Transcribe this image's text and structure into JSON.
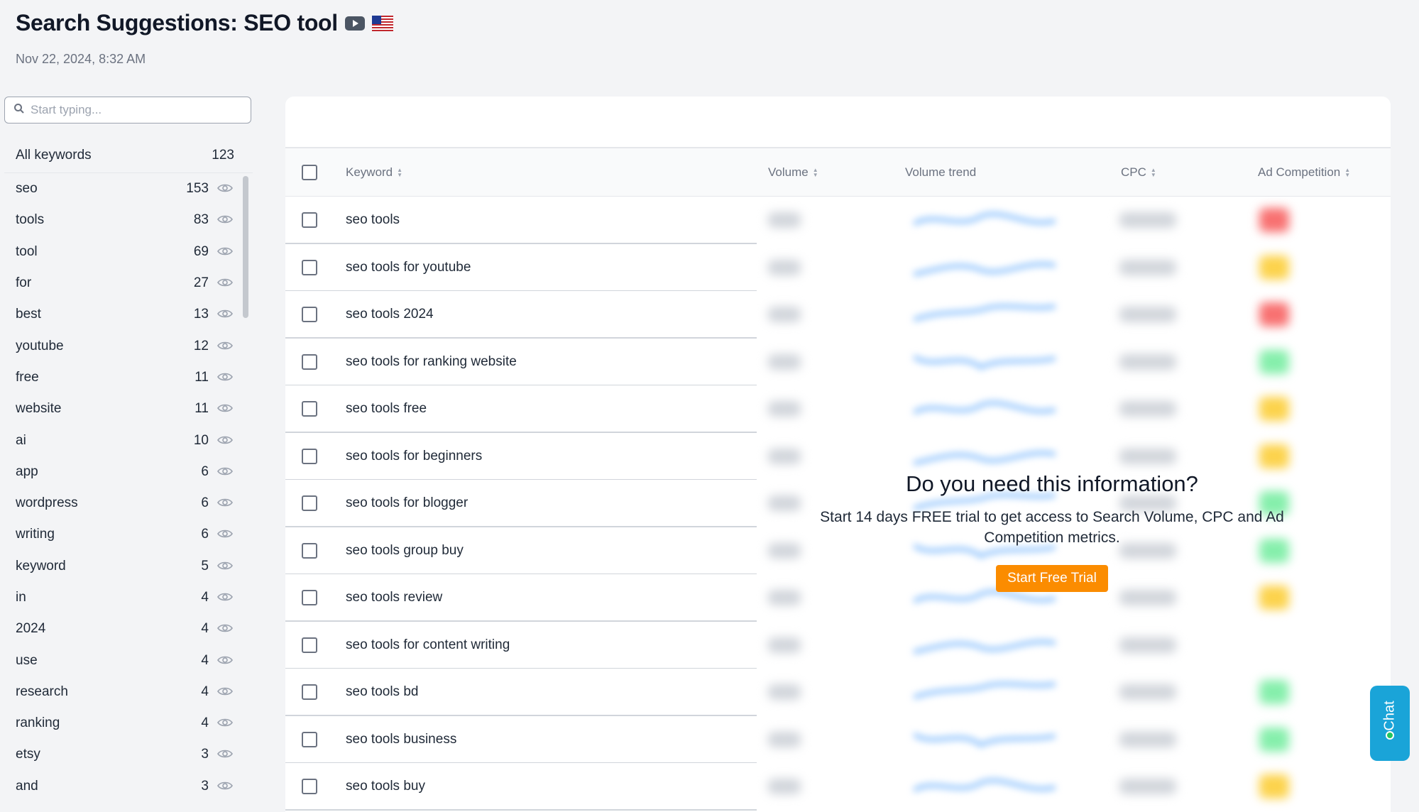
{
  "header": {
    "title": "Search Suggestions: SEO tool",
    "date": "Nov 22, 2024, 8:32 AM"
  },
  "sidebar": {
    "search_placeholder": "Start typing...",
    "all_label": "All keywords",
    "all_count": "123",
    "items": [
      {
        "label": "seo",
        "count": "153"
      },
      {
        "label": "tools",
        "count": "83"
      },
      {
        "label": "tool",
        "count": "69"
      },
      {
        "label": "for",
        "count": "27"
      },
      {
        "label": "best",
        "count": "13"
      },
      {
        "label": "youtube",
        "count": "12"
      },
      {
        "label": "free",
        "count": "11"
      },
      {
        "label": "website",
        "count": "11"
      },
      {
        "label": "ai",
        "count": "10"
      },
      {
        "label": "app",
        "count": "6"
      },
      {
        "label": "wordpress",
        "count": "6"
      },
      {
        "label": "writing",
        "count": "6"
      },
      {
        "label": "keyword",
        "count": "5"
      },
      {
        "label": "in",
        "count": "4"
      },
      {
        "label": "2024",
        "count": "4"
      },
      {
        "label": "use",
        "count": "4"
      },
      {
        "label": "research",
        "count": "4"
      },
      {
        "label": "ranking",
        "count": "4"
      },
      {
        "label": "etsy",
        "count": "3"
      },
      {
        "label": "and",
        "count": "3"
      }
    ]
  },
  "table": {
    "columns": {
      "keyword": "Keyword",
      "volume": "Volume",
      "trend": "Volume trend",
      "cpc": "CPC",
      "competition": "Ad Competition"
    },
    "rows": [
      {
        "keyword": "seo tools",
        "competition_color": "#f87171"
      },
      {
        "keyword": "seo tools for youtube",
        "competition_color": "#fcd34d"
      },
      {
        "keyword": "seo tools 2024",
        "competition_color": "#f87171"
      },
      {
        "keyword": "seo tools for ranking website",
        "competition_color": "#86efac"
      },
      {
        "keyword": "seo tools free",
        "competition_color": "#fcd34d"
      },
      {
        "keyword": "seo tools for beginners",
        "competition_color": "#fcd34d"
      },
      {
        "keyword": "seo tools for blogger",
        "competition_color": "#86efac"
      },
      {
        "keyword": "seo tools group buy",
        "competition_color": "#86efac"
      },
      {
        "keyword": "seo tools review",
        "competition_color": "#fcd34d"
      },
      {
        "keyword": "seo tools for content writing",
        "competition_color": ""
      },
      {
        "keyword": "seo tools bd",
        "competition_color": "#86efac"
      },
      {
        "keyword": "seo tools business",
        "competition_color": "#86efac"
      },
      {
        "keyword": "seo tools buy",
        "competition_color": "#fcd34d"
      }
    ]
  },
  "paywall": {
    "heading": "Do you need this information?",
    "text": "Start 14 days FREE trial to get access to Search Volume, CPC and Ad Competition metrics.",
    "button": "Start Free Trial"
  },
  "chat": {
    "label": "Chat"
  }
}
